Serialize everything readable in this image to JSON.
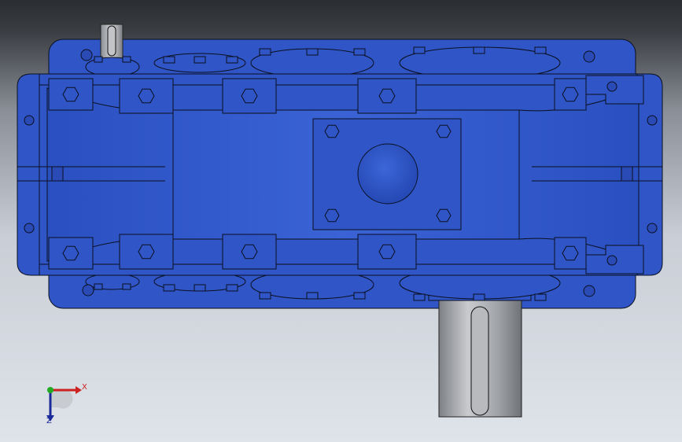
{
  "viewport": {
    "background_top": "#2a2d31",
    "background_bottom": "#dfe3ea"
  },
  "model": {
    "body_color": "#2f55c6",
    "body_dark": "#1e3a99",
    "outline_color": "#0b1020",
    "shaft_color": "#a9abaf",
    "icons": [
      "gearbox-housing",
      "output-shaft",
      "input-shaft",
      "mounting-boss",
      "bolt-hex"
    ]
  },
  "triad": {
    "x_label": "X",
    "z_label": "Z",
    "x_color": "#cc2222",
    "y_color": "#22aa22",
    "z_color": "#1a2a99"
  }
}
